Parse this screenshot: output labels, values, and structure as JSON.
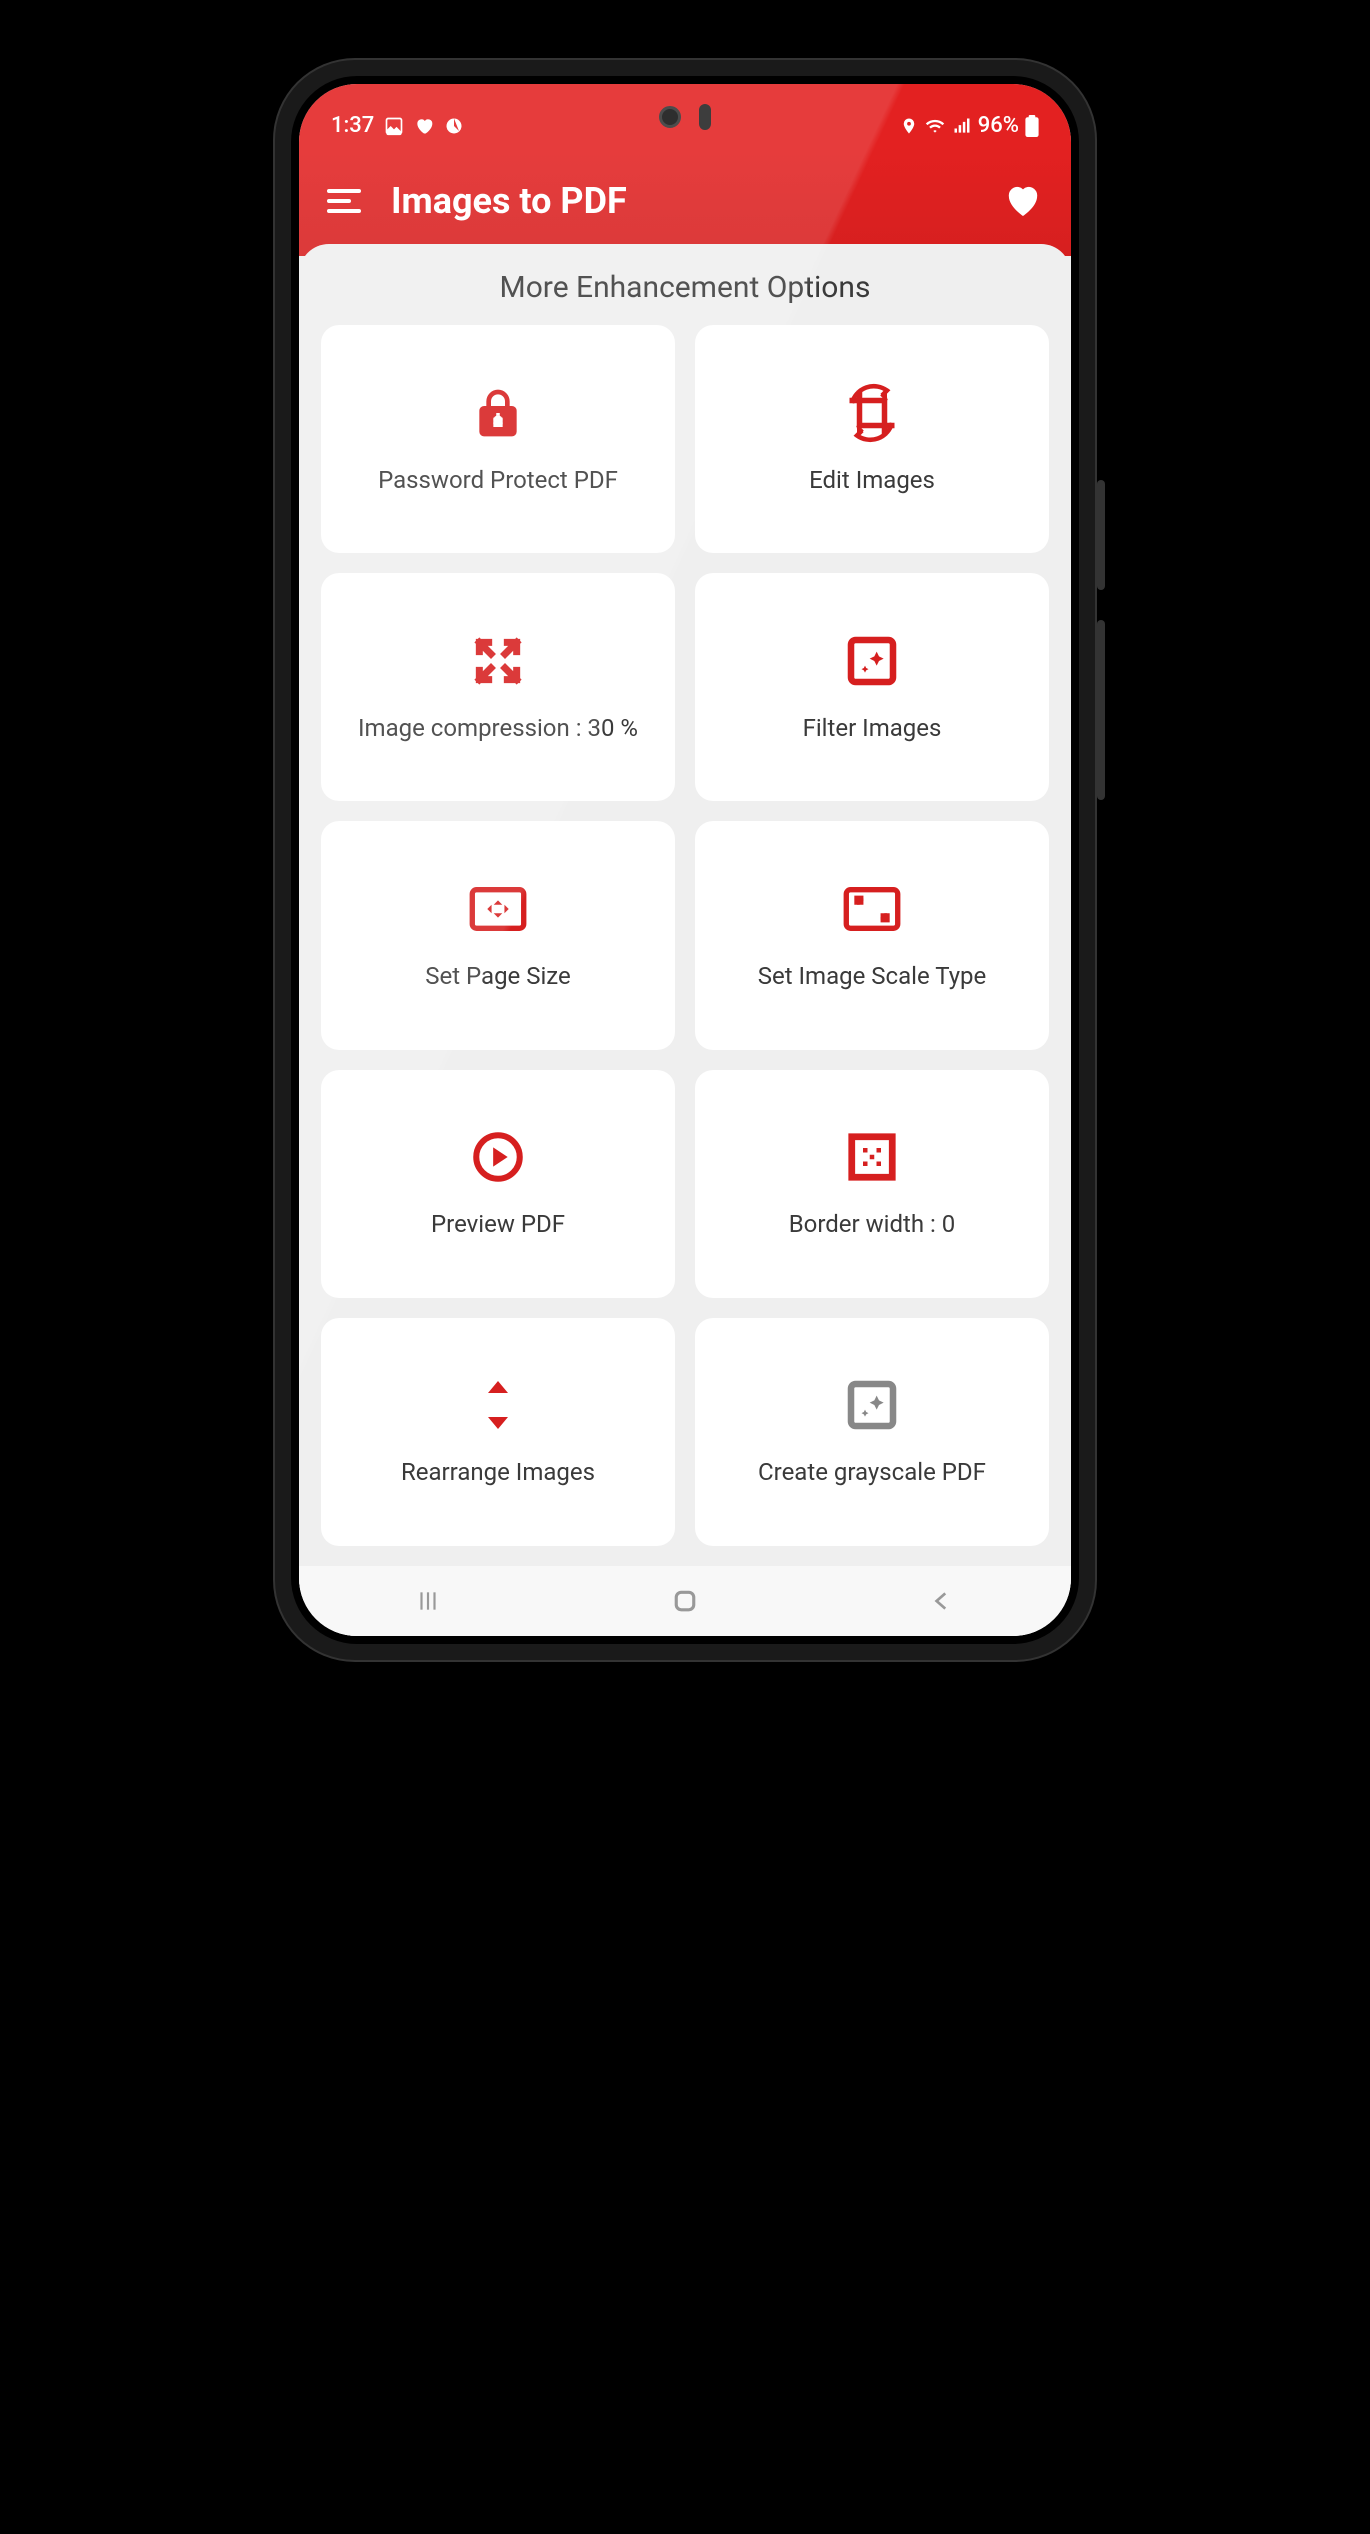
{
  "status": {
    "time": "1:37",
    "battery_text": "96%"
  },
  "header": {
    "title": "Images to PDF"
  },
  "section": {
    "title": "More Enhancement Options"
  },
  "cards": {
    "password": "Password Protect PDF",
    "edit": "Edit Images",
    "compression": "Image compression : 30 %",
    "filter": "Filter Images",
    "pagesize": "Set Page Size",
    "scaletype": "Set Image Scale Type",
    "preview": "Preview PDF",
    "border": "Border width : 0",
    "rearrange": "Rearrange Images",
    "grayscale": "Create grayscale PDF"
  }
}
